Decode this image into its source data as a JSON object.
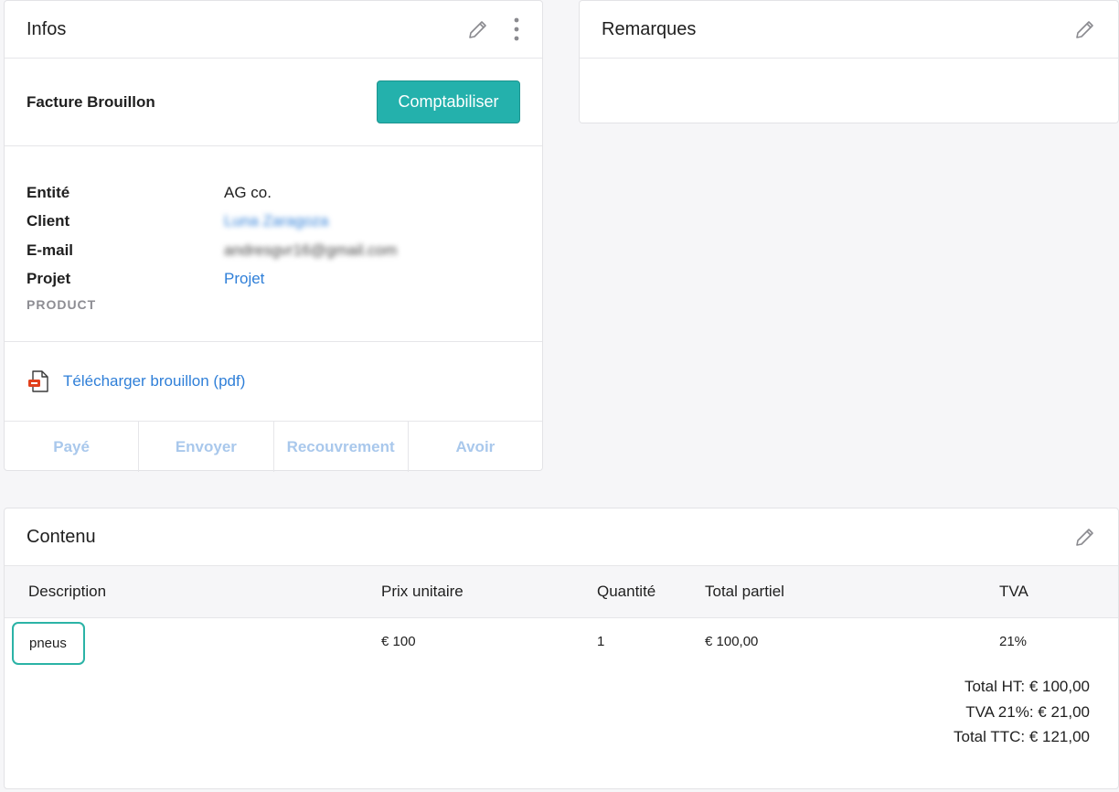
{
  "infos": {
    "title": "Infos",
    "draft_title": "Facture Brouillon",
    "primary_button": "Comptabiliser",
    "fields": [
      {
        "label": "Entité",
        "value": "AG co."
      },
      {
        "label": "Client",
        "value": "Luna Zaragoza"
      },
      {
        "label": "E-mail",
        "value": "andresgvr16@gmail.com"
      },
      {
        "label": "Projet",
        "value": "Projet"
      }
    ],
    "product_label": "PRODUCT",
    "download_label": "Télécharger brouillon (pdf)",
    "actions": [
      "Payé",
      "Envoyer",
      "Recouvrement",
      "Avoir"
    ]
  },
  "remarques": {
    "title": "Remarques"
  },
  "contenu": {
    "title": "Contenu",
    "columns": [
      "Description",
      "Prix unitaire",
      "Quantité",
      "Total partiel",
      "TVA"
    ],
    "rows": [
      {
        "description": "pneus",
        "price": "€ 100",
        "quantity": "1",
        "subtotal": "€ 100,00",
        "vat": "21%"
      }
    ],
    "totals": [
      "Total HT: € 100,00",
      "TVA 21%: € 21,00",
      "Total TTC: € 121,00"
    ]
  },
  "colors": {
    "accent": "#24b1ac",
    "link": "#2f7fd8",
    "disabled_action": "#a9c8ec",
    "highlight": "#2bb3a6"
  }
}
